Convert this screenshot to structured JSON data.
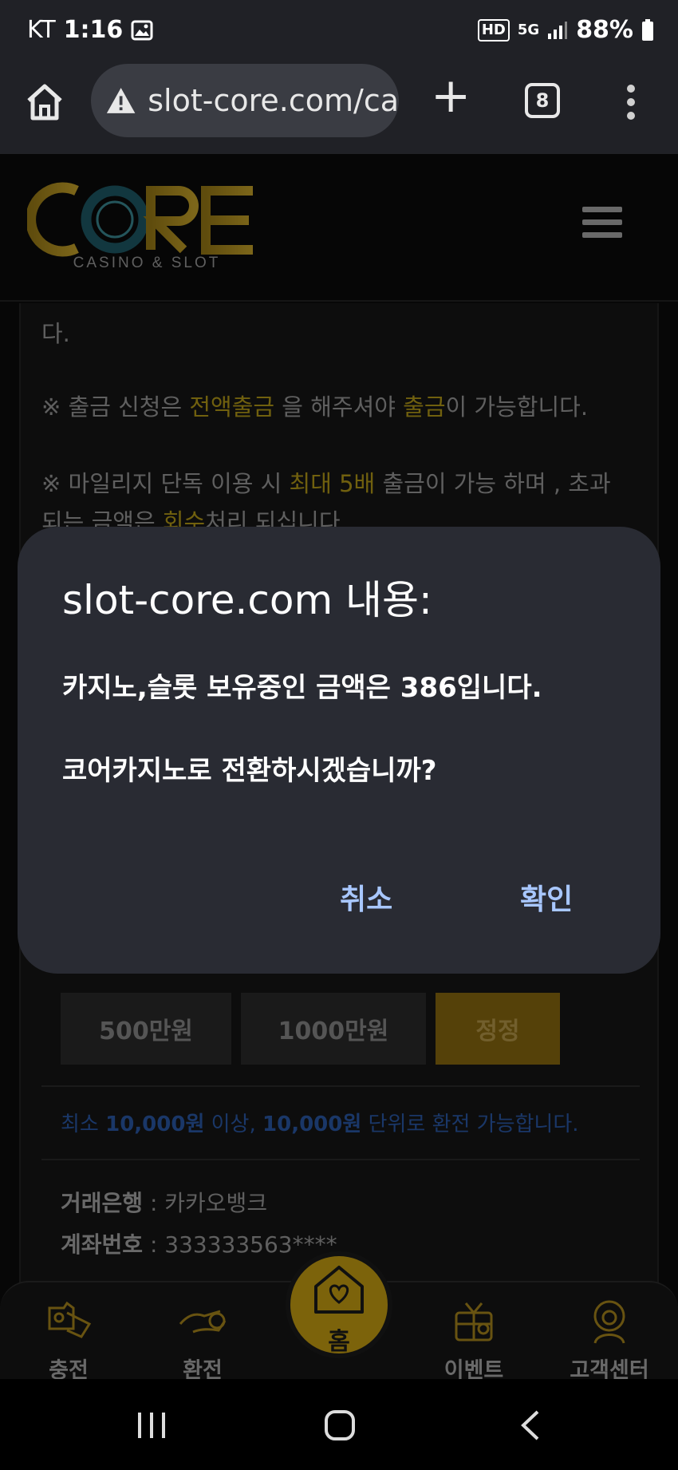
{
  "status_bar": {
    "carrier": "KT",
    "time": "1:16",
    "hd": "HD",
    "network": "5G",
    "battery": "88%"
  },
  "browser": {
    "url": "slot-core.com/ca",
    "tab_count": "8"
  },
  "site": {
    "logo_text": "CORE",
    "logo_sub": "CASINO & SLOT"
  },
  "notices": {
    "line0": "다.",
    "line1_a": "※ 출금 신청은 ",
    "line1_b": "전액출금",
    "line1_c": " 을 해주셔야 ",
    "line1_d": "출금",
    "line1_e": "이 가능합니다.",
    "line2_a": "※ 마일리지 단독 이용 시 ",
    "line2_b": "최대 5배",
    "line2_c": " 출금이 가능 하며 , 초과",
    "line3_a": "되는 금액은 ",
    "line3_b": "회수",
    "line3_c": "처리 되십니다."
  },
  "amount_buttons": {
    "b500": "500만원",
    "b1000": "1000만원",
    "reset": "정정"
  },
  "exchange_info": {
    "a": "최소 ",
    "b": "10,000원",
    "c": " 이상, ",
    "d": "10,000원",
    "e": "  단위로 환전 가능합니다."
  },
  "bank": {
    "bank_label": "거래은행",
    "bank_value": " : 카카오뱅크",
    "acct_label": "계좌번호",
    "acct_value": " : 333333563****"
  },
  "dialog": {
    "title": "slot-core.com 내용:",
    "message1": "카지노,슬롯 보유중인 금액은 386입니다.",
    "message2": "코어카지노로 전환하시겠습니까?",
    "cancel": "취소",
    "confirm": "확인"
  },
  "bottom_nav": {
    "charge": "충전",
    "exchange": "환전",
    "home": "홈",
    "event": "이벤트",
    "support": "고객센터"
  },
  "colors": {
    "accent_gold": "#c9a012",
    "dialog_bg": "#292b33",
    "dialog_button": "#a8c7ff"
  }
}
